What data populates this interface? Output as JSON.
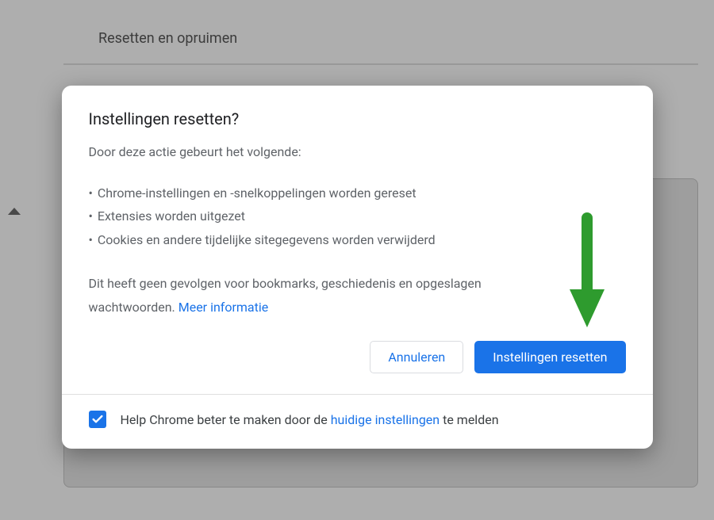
{
  "section": {
    "title": "Resetten en opruimen"
  },
  "dialog": {
    "title": "Instellingen resetten?",
    "intro": "Door deze actie gebeurt het volgende:",
    "bullets": [
      "Chrome-instellingen en -snelkoppelingen worden gereset",
      "Extensies worden uitgezet",
      "Cookies en andere tijdelijke sitegegevens worden verwijderd"
    ],
    "note_prefix": "Dit heeft geen gevolgen voor bookmarks, geschiedenis en opgeslagen wachtwoorden. ",
    "note_link": "Meer informatie",
    "actions": {
      "cancel": "Annuleren",
      "confirm": "Instellingen resetten"
    }
  },
  "footer": {
    "checkbox_checked": true,
    "text_prefix": "Help Chrome beter te maken door de ",
    "text_link": "huidige instellingen",
    "text_suffix": " te melden"
  },
  "colors": {
    "accent": "#1a73e8",
    "arrow": "#2e9b2e"
  }
}
